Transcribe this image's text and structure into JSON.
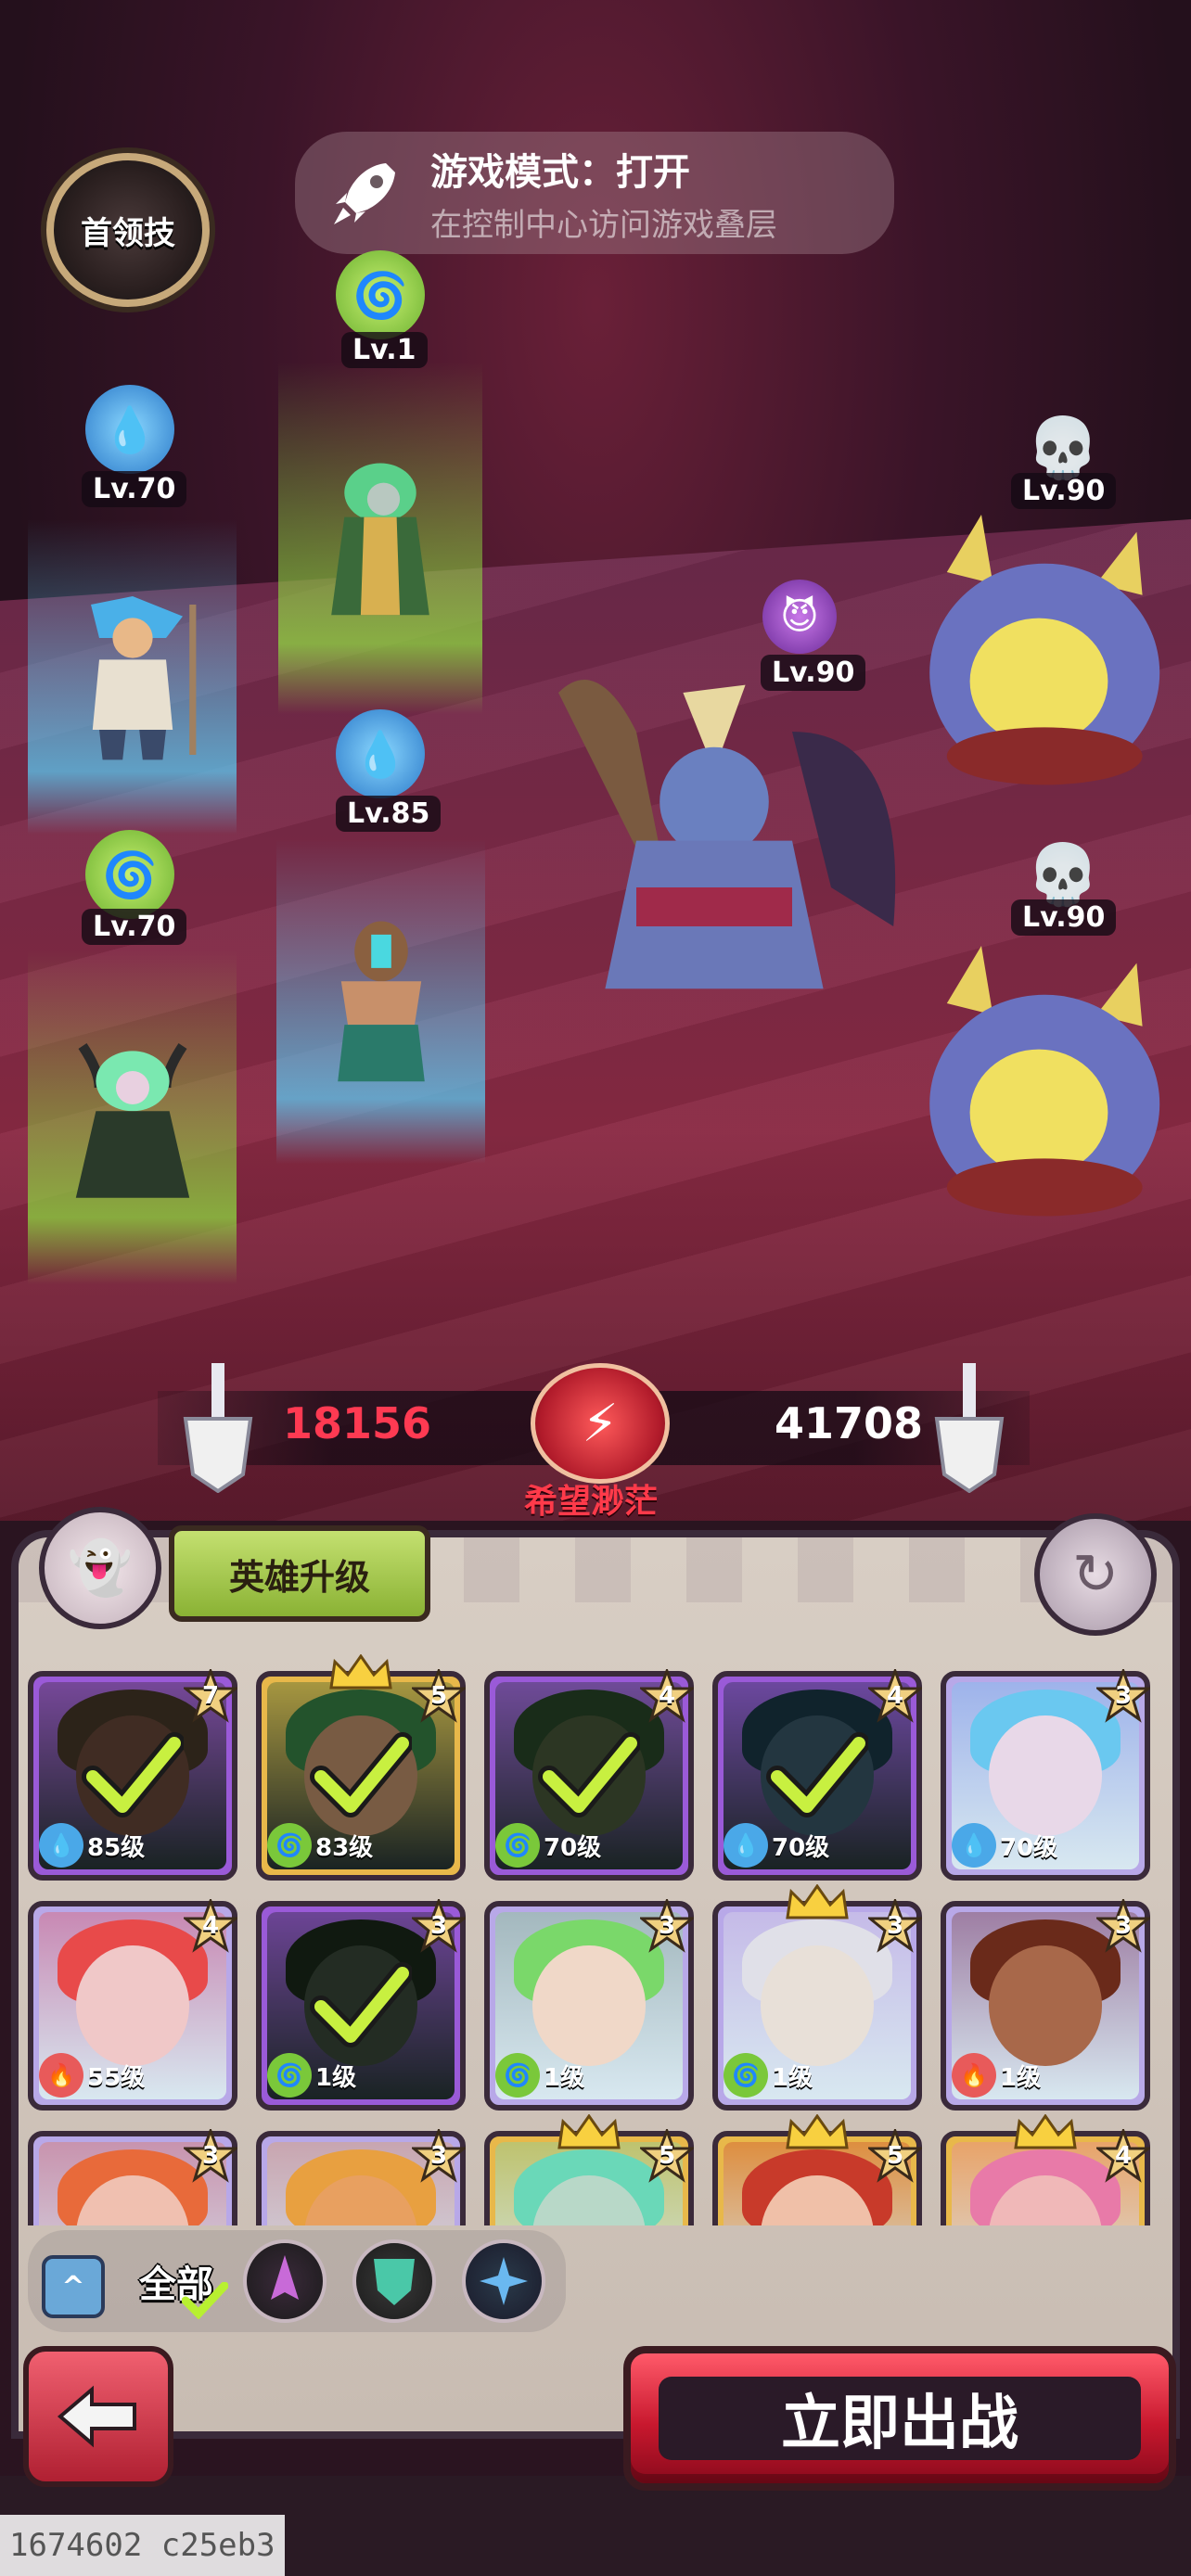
{
  "game_mode_toast": {
    "title": "游戏模式：打开",
    "subtitle": "在控制中心访问游戏叠层"
  },
  "boss_skill_button": "首领技",
  "player_team": [
    {
      "level": "Lv.1",
      "element": "wind",
      "glow": "#9ee05a"
    },
    {
      "level": "Lv.70",
      "element": "water",
      "glow": "#5ac8f0"
    },
    {
      "level": "Lv.85",
      "element": "water",
      "glow": "#5ac8f0"
    },
    {
      "level": "Lv.70",
      "element": "wind",
      "glow": "#9ee05a"
    }
  ],
  "enemy_team": [
    {
      "level": "Lv.90",
      "icon": "skull-icon"
    },
    {
      "level": "Lv.90",
      "icon": "demon-icon"
    },
    {
      "level": "Lv.90",
      "icon": "skull-icon"
    }
  ],
  "power": {
    "player": "18156",
    "enemy": "41708",
    "status": "希望渺茫"
  },
  "panel": {
    "upgrade_label": "英雄升级"
  },
  "heroes": [
    {
      "stars": "7",
      "level": "85级",
      "element": "water",
      "selected": true,
      "frame": "#9a5ad8",
      "crown": false
    },
    {
      "stars": "5",
      "level": "83级",
      "element": "wind",
      "selected": true,
      "frame": "#e8b84a",
      "crown": true
    },
    {
      "stars": "4",
      "level": "70级",
      "element": "wind",
      "selected": true,
      "frame": "#9a5ad8",
      "crown": false
    },
    {
      "stars": "4",
      "level": "70级",
      "element": "water",
      "selected": true,
      "frame": "#9a5ad8",
      "crown": false
    },
    {
      "stars": "3",
      "level": "70级",
      "element": "water",
      "selected": false,
      "frame": "#b8a8e8",
      "crown": false
    },
    {
      "stars": "4",
      "level": "55级",
      "element": "fire",
      "selected": false,
      "frame": "#b8a8e8",
      "crown": false
    },
    {
      "stars": "3",
      "level": "1级",
      "element": "wind",
      "selected": true,
      "frame": "#9a5ad8",
      "crown": false
    },
    {
      "stars": "3",
      "level": "1级",
      "element": "wind",
      "selected": false,
      "frame": "#b8a8e8",
      "crown": false
    },
    {
      "stars": "3",
      "level": "1级",
      "element": "wind",
      "selected": false,
      "frame": "#b8a8e8",
      "crown": true
    },
    {
      "stars": "3",
      "level": "1级",
      "element": "fire",
      "selected": false,
      "frame": "#b8a8e8",
      "crown": false
    },
    {
      "stars": "3",
      "level": "",
      "element": "fire",
      "selected": false,
      "frame": "#b8a8e8",
      "crown": false
    },
    {
      "stars": "3",
      "level": "",
      "element": "fire",
      "selected": false,
      "frame": "#b8a8e8",
      "crown": false
    },
    {
      "stars": "5",
      "level": "",
      "element": "wind",
      "selected": false,
      "frame": "#e8b84a",
      "crown": true
    },
    {
      "stars": "5",
      "level": "",
      "element": "fire",
      "selected": false,
      "frame": "#e8b84a",
      "crown": true
    },
    {
      "stars": "4",
      "level": "",
      "element": "fire",
      "selected": false,
      "frame": "#e8b84a",
      "crown": true
    }
  ],
  "filters": {
    "all_label": "全部"
  },
  "fight_button": "立即出战",
  "watermark": "1674602 c25eb3",
  "colors": {
    "water": "#4aa8e8",
    "wind": "#7ac83a",
    "fire": "#e85a5a",
    "danger": "#ff3a52"
  }
}
